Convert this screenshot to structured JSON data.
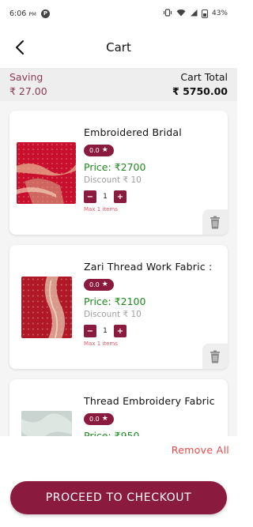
{
  "status_bar": {
    "time": "6:06",
    "ampm": "PM",
    "app_icon": "P",
    "battery": "43%",
    "icons": [
      "vibrate-icon",
      "wifi-icon",
      "signal-icon",
      "battery-icon"
    ]
  },
  "header": {
    "title": "Cart",
    "back_icon": "chevron-left-icon"
  },
  "summary": {
    "saving_label": "Saving",
    "saving_value": "₹ 27.00",
    "total_label": "Cart Total",
    "total_value": "₹ 5750.00"
  },
  "items": [
    {
      "name": "Embroidered Bridal",
      "rating": "0.0",
      "price": "Price: ₹2700",
      "discount": "Discount ₹ 10",
      "qty": "1",
      "max": "Max 1 items"
    },
    {
      "name": "Zari Thread Work Fabric :",
      "rating": "0.0",
      "price": "Price: ₹2100",
      "discount": "Discount ₹ 10",
      "qty": "1",
      "max": "Max 1 items"
    },
    {
      "name": "Thread Embroidery Fabric",
      "rating": "0.0",
      "price": "Price: ₹950",
      "discount": "",
      "qty": "",
      "max": ""
    }
  ],
  "stepper": {
    "minus": "−",
    "plus": "+"
  },
  "actions": {
    "remove_all": "Remove All",
    "checkout": "PROCEED TO CHECKOUT"
  },
  "colors": {
    "accent": "#8a1a3e",
    "price": "#1f8a1f",
    "remove": "#e84a4a",
    "saving": "#8a3a58"
  }
}
